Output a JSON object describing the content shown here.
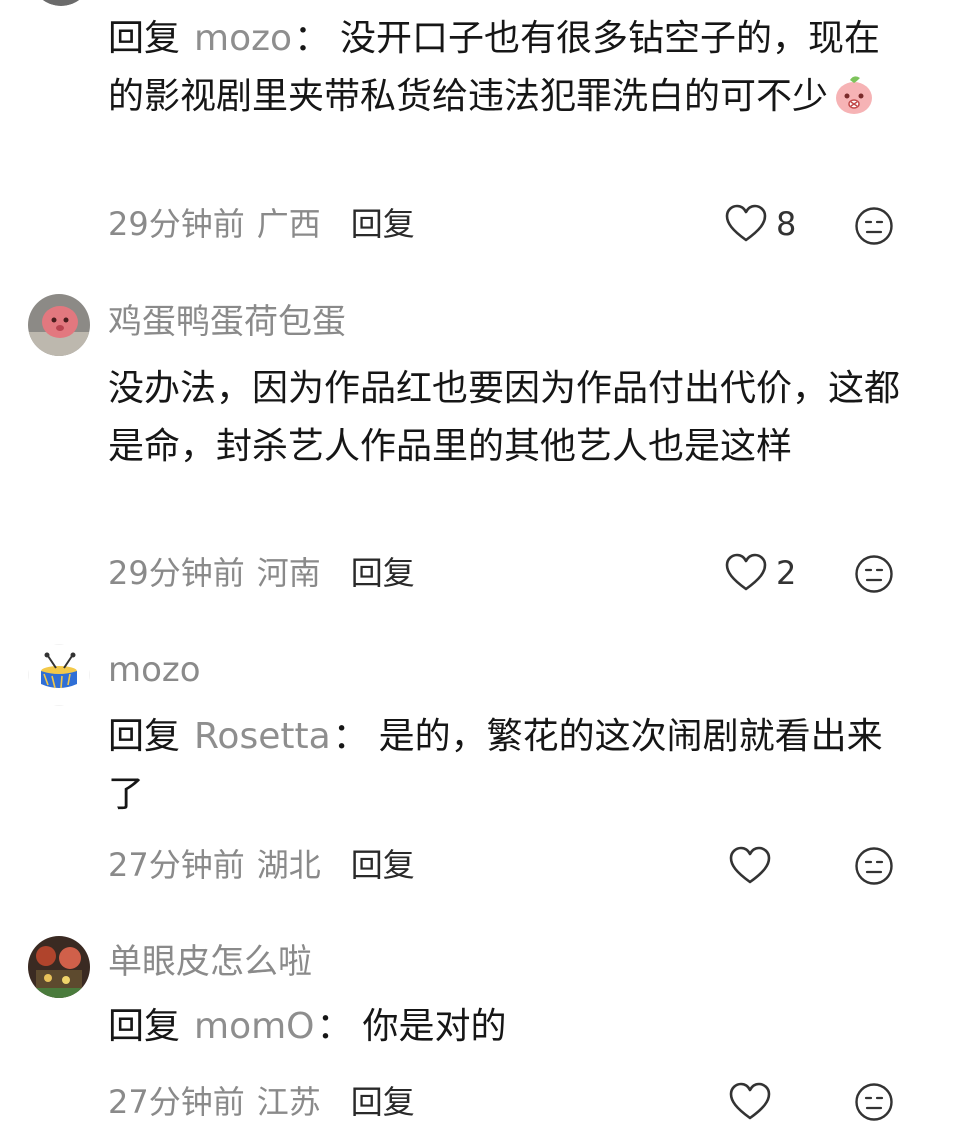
{
  "comments": [
    {
      "reply_prefix": "回复",
      "reply_target": "mozo",
      "reply_colon": "：",
      "text": "没开口子也有很多钻空子的，现在的影视剧里夹带私货给违法犯罪洗白的可不少",
      "time": "29分钟前",
      "location": "广西",
      "reply_label": "回复",
      "likes": "8"
    },
    {
      "username": "鸡蛋鸭蛋荷包蛋",
      "text": "没办法，因为作品红也要因为作品付出代价，这都是命，封杀艺人作品里的其他艺人也是这样",
      "time": "29分钟前",
      "location": "河南",
      "reply_label": "回复",
      "likes": "2"
    },
    {
      "username": "mozo",
      "reply_prefix": "回复",
      "reply_target": "Rosetta",
      "reply_colon": "：",
      "text": "是的，繁花的这次闹剧就看出来了",
      "time": "27分钟前",
      "location": "湖北",
      "reply_label": "回复"
    },
    {
      "username": "单眼皮怎么啦",
      "reply_prefix": "回复",
      "reply_target": "momO",
      "reply_colon": "：",
      "text": "你是对的",
      "time": "27分钟前",
      "location": "江苏",
      "reply_label": "回复"
    }
  ],
  "icons": {
    "like": "heart-outline-icon",
    "react": "neutral-face-icon"
  },
  "colors": {
    "text": "#161616",
    "muted": "#8a8a8a",
    "background": "#ffffff"
  }
}
